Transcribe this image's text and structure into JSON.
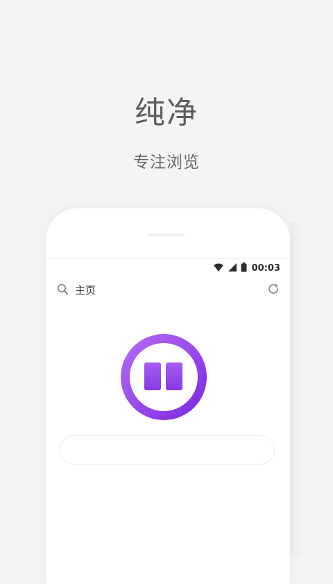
{
  "hero": {
    "title": "纯净",
    "subtitle": "专注浏览"
  },
  "device": {
    "status_bar": {
      "time": "00:03",
      "icons": [
        "wifi-icon",
        "cellular-signal-icon",
        "battery-icon"
      ]
    },
    "toolbar": {
      "label": "主页",
      "left_icon": "search-icon",
      "right_icon": "refresh-icon"
    },
    "logo": {
      "icon": "open-book-icon"
    },
    "url_bar": {
      "placeholder": ""
    }
  },
  "colors": {
    "accent": "#8d38e8",
    "accent_light": "#b56cf2",
    "background": "#f4f3f5"
  }
}
